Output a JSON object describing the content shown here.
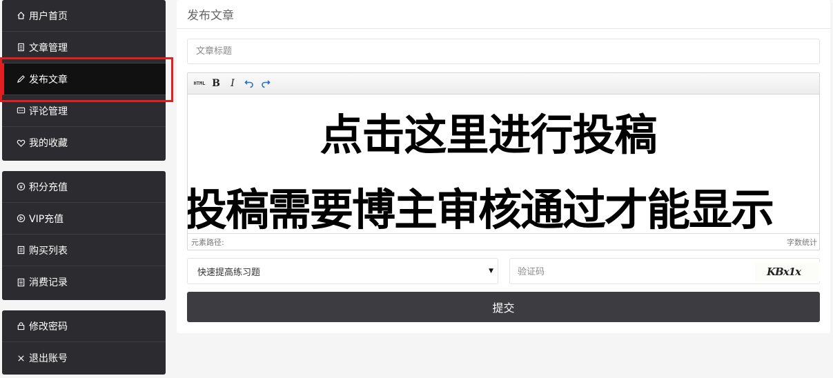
{
  "sidebar": {
    "group1": [
      {
        "label": "用户首页",
        "icon": "home-icon"
      },
      {
        "label": "文章管理",
        "icon": "document-icon"
      },
      {
        "label": "发布文章",
        "icon": "pencil-icon",
        "active": true
      },
      {
        "label": "评论管理",
        "icon": "comment-icon"
      },
      {
        "label": "我的收藏",
        "icon": "heart-icon"
      }
    ],
    "group2": [
      {
        "label": "积分充值",
        "icon": "coin-icon"
      },
      {
        "label": "VIP充值",
        "icon": "vip-icon"
      },
      {
        "label": "购买列表",
        "icon": "list-icon"
      },
      {
        "label": "消费记录",
        "icon": "receipt-icon"
      }
    ],
    "group3": [
      {
        "label": "修改密码",
        "icon": "lock-icon"
      },
      {
        "label": "退出账号",
        "icon": "close-icon"
      }
    ]
  },
  "main": {
    "title": "发布文章",
    "article_title_placeholder": "文章标题",
    "editor": {
      "toolbar": [
        "HTML",
        "B",
        "I",
        "undo",
        "redo"
      ],
      "line1": "点击这里进行投稿",
      "line2": "投稿需要博主审核通过才能显示",
      "path_label": "元素路径:",
      "count_label": "字数统计"
    },
    "category_select": {
      "selected": "快速提高练习题"
    },
    "captcha": {
      "placeholder": "验证码",
      "image_text": "KBx1x"
    },
    "submit_label": "提交"
  },
  "colors": {
    "sidebar_bg": "#2c2c30",
    "active_bg": "#111111",
    "highlight": "#e02020",
    "submit_bg": "#3d3c40"
  }
}
